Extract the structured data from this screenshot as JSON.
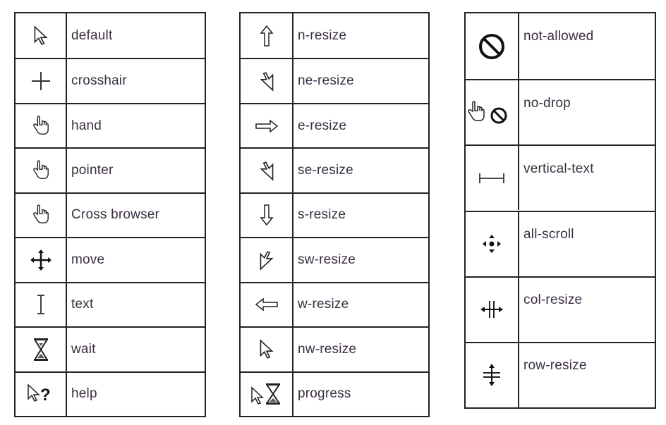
{
  "tables": [
    {
      "name": "cursor-table-1",
      "rows": [
        {
          "icon": "default-arrow-icon",
          "label": "default"
        },
        {
          "icon": "crosshair-icon",
          "label": "crosshair"
        },
        {
          "icon": "hand-icon",
          "label": "hand"
        },
        {
          "icon": "hand-icon",
          "label": "pointer"
        },
        {
          "icon": "hand-icon",
          "label": "Cross browser"
        },
        {
          "icon": "move-icon",
          "label": "move"
        },
        {
          "icon": "text-ibeam-icon",
          "label": "text"
        },
        {
          "icon": "hourglass-icon",
          "label": "wait"
        },
        {
          "icon": "help-arrow-question-icon",
          "label": "help"
        }
      ]
    },
    {
      "name": "cursor-table-2",
      "rows": [
        {
          "icon": "arrow-up-icon",
          "label": "n-resize"
        },
        {
          "icon": "arrow-ne-icon",
          "label": "ne-resize"
        },
        {
          "icon": "arrow-right-icon",
          "label": "e-resize"
        },
        {
          "icon": "arrow-se-icon",
          "label": "se-resize"
        },
        {
          "icon": "arrow-down-icon",
          "label": "s-resize"
        },
        {
          "icon": "arrow-sw-icon",
          "label": "sw-resize"
        },
        {
          "icon": "arrow-left-icon",
          "label": "w-resize"
        },
        {
          "icon": "arrow-nw-icon",
          "label": "nw-resize"
        },
        {
          "icon": "arrow-hourglass-icon",
          "label": "progress"
        }
      ]
    },
    {
      "name": "cursor-table-3",
      "rows": [
        {
          "icon": "not-allowed-icon",
          "label": "not-allowed"
        },
        {
          "icon": "hand-no-drop-icon",
          "label": "no-drop"
        },
        {
          "icon": "vertical-text-icon",
          "label": "vertical-text"
        },
        {
          "icon": "all-scroll-icon",
          "label": "all-scroll"
        },
        {
          "icon": "col-resize-icon",
          "label": "col-resize"
        },
        {
          "icon": "row-resize-icon",
          "label": "row-resize"
        }
      ]
    }
  ]
}
